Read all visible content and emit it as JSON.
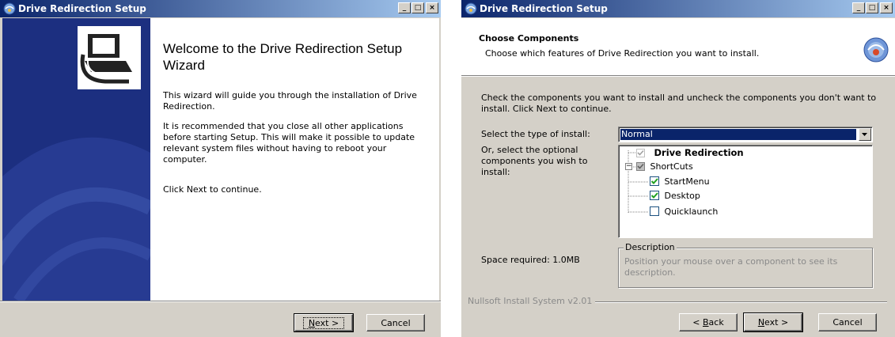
{
  "welcome_window": {
    "title": "Drive Redirection Setup",
    "window_buttons": [
      "_",
      "□",
      "×"
    ],
    "heading": "Welcome to the Drive Redirection Setup Wizard",
    "paragraphs": [
      "This wizard will guide you through the installation of Drive Redirection.",
      "It is recommended that you close all other applications before starting Setup. This will make it possible to update relevant system files without having to reboot your computer.",
      "Click Next to continue."
    ],
    "buttons": {
      "next_pre": "N",
      "next_rest": "ext >",
      "cancel": "Cancel"
    }
  },
  "components_window": {
    "title": "Drive Redirection Setup",
    "window_buttons": [
      "_",
      "□",
      "×"
    ],
    "header_title": "Choose Components",
    "header_subtitle": "Choose which features of Drive Redirection you want to install.",
    "instructions": "Check the components you want to install and uncheck the components you don't want to install. Click Next to continue.",
    "install_type_label": "Select the type of install:",
    "install_type_value": "Normal",
    "optional_label": "Or, select the optional components you wish to install:",
    "tree": [
      {
        "label": "Drive Redirection",
        "state": "checked-disabled",
        "bold": true
      },
      {
        "label": "ShortCuts",
        "state": "checked-grey",
        "expander": "−"
      },
      {
        "label": "StartMenu",
        "state": "checked"
      },
      {
        "label": "Desktop",
        "state": "checked"
      },
      {
        "label": "Quicklaunch",
        "state": "unchecked"
      }
    ],
    "space_required": "Space required: 1.0MB",
    "description_title": "Description",
    "description_text": "Position your mouse over a component to see its description.",
    "branding": "Nullsoft Install System v2.01",
    "buttons": {
      "back_pre": "< ",
      "back_u": "B",
      "back_rest": "ack",
      "next_u": "N",
      "next_rest": "ext >",
      "cancel": "Cancel"
    }
  }
}
